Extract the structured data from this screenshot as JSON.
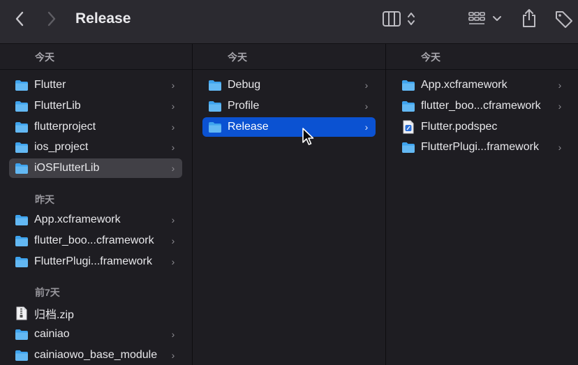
{
  "toolbar": {
    "title": "Release",
    "icons": [
      "chevron-left-icon",
      "chevron-right-icon",
      "column-view-icon",
      "group-grid-icon",
      "share-icon",
      "tag-icon"
    ]
  },
  "columns": [
    {
      "header": "今天",
      "sections": [
        {
          "label": "",
          "items": [
            {
              "name": "Flutter",
              "type": "folder",
              "chevron": "›",
              "selected": false
            },
            {
              "name": "FlutterLib",
              "type": "folder",
              "chevron": "›",
              "selected": false
            },
            {
              "name": "flutterproject",
              "type": "folder",
              "chevron": "›",
              "selected": false
            },
            {
              "name": "ios_project",
              "type": "folder",
              "chevron": "›",
              "selected": false
            },
            {
              "name": "iOSFlutterLib",
              "type": "folder",
              "chevron": "›",
              "selected": "gray"
            }
          ]
        },
        {
          "label": "昨天",
          "items": [
            {
              "name": "App.xcframework",
              "type": "folder",
              "chevron": "›",
              "selected": false
            },
            {
              "name": "flutter_boo...cframework",
              "type": "folder",
              "chevron": "›",
              "selected": false
            },
            {
              "name": "FlutterPlugi...framework",
              "type": "folder",
              "chevron": "›",
              "selected": false
            }
          ]
        },
        {
          "label": "前7天",
          "items": [
            {
              "name": "归档.zip",
              "type": "zip",
              "chevron": "",
              "selected": false
            },
            {
              "name": "cainiao",
              "type": "folder",
              "chevron": "›",
              "selected": false
            },
            {
              "name": "cainiaowo_base_module",
              "type": "folder",
              "chevron": "›",
              "selected": false
            }
          ]
        }
      ]
    },
    {
      "header": "今天",
      "items": [
        {
          "name": "Debug",
          "type": "folder",
          "chevron": "›",
          "selected": false
        },
        {
          "name": "Profile",
          "type": "folder",
          "chevron": "›",
          "selected": false
        },
        {
          "name": "Release",
          "type": "folder",
          "chevron": "›",
          "selected": "blue"
        }
      ]
    },
    {
      "header": "今天",
      "items": [
        {
          "name": "App.xcframework",
          "type": "folder",
          "chevron": "›",
          "selected": false
        },
        {
          "name": "flutter_boo...cframework",
          "type": "folder",
          "chevron": "›",
          "selected": false
        },
        {
          "name": "Flutter.podspec",
          "type": "podspec",
          "chevron": "",
          "selected": false
        },
        {
          "name": "FlutterPlugi...framework",
          "type": "folder",
          "chevron": "›",
          "selected": false
        }
      ]
    }
  ],
  "colors": {
    "folder": "#3ea3ee",
    "selection_blue": "#0b52d2",
    "selection_gray": "#414046",
    "background": "#1e1d22",
    "toolbar": "#2b2a30"
  }
}
